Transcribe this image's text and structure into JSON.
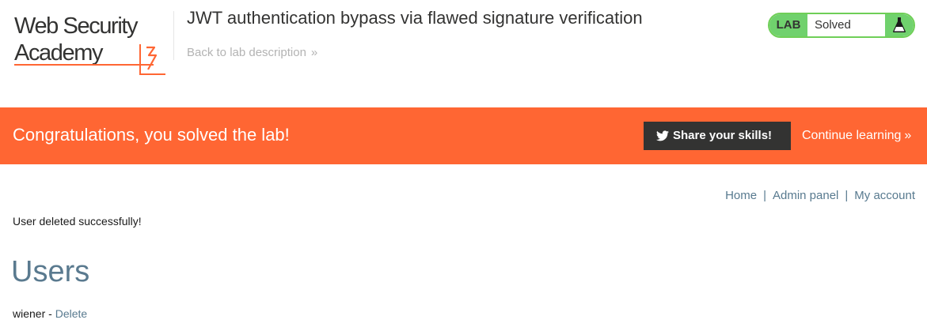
{
  "header": {
    "logo": {
      "line1": "Web Security",
      "line2": "Academy",
      "accent_color": "#ff6633"
    },
    "lab_title": "JWT authentication bypass via flawed signature verification",
    "back_link": {
      "label": "Back to lab description",
      "chevron": "»"
    },
    "lab_status": {
      "label": "LAB",
      "state": "Solved",
      "icon": "flask-icon",
      "color": "#70d16d"
    }
  },
  "banner": {
    "message": "Congratulations, you solved the lab!",
    "share_button": {
      "label": "Share your skills!",
      "icon": "twitter-icon"
    },
    "continue_link": {
      "label": "Continue learning",
      "chevron": "»"
    },
    "color": "#ff6633"
  },
  "nav": {
    "items": [
      {
        "label": "Home"
      },
      {
        "label": "Admin panel"
      },
      {
        "label": "My account"
      }
    ],
    "separator": "|"
  },
  "main": {
    "status_message": "User deleted successfully!",
    "heading": "Users",
    "users": [
      {
        "name": "wiener",
        "separator": " - ",
        "action": "Delete"
      }
    ]
  }
}
